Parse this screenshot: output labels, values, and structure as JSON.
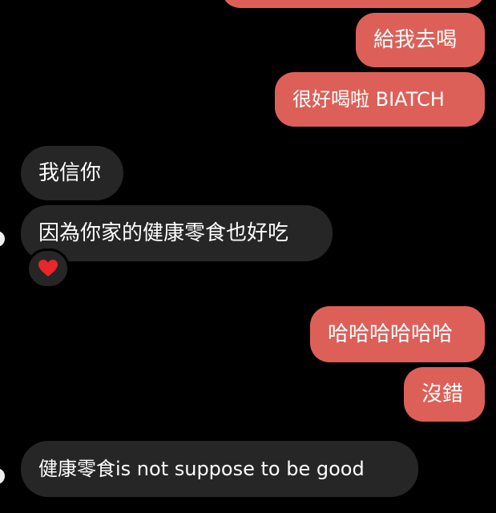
{
  "messages": {
    "outgoing": [
      {
        "text": "給我去喝"
      },
      {
        "text": "很好喝啦 BIATCH"
      },
      {
        "text": "哈哈哈哈哈哈"
      },
      {
        "text": "沒錯"
      }
    ],
    "incoming": [
      {
        "text": "我信你"
      },
      {
        "text": "因為你家的健康零食也好吃"
      },
      {
        "text": "健康零食is not suppose to be good"
      }
    ]
  },
  "reaction": {
    "icon": "heart-icon",
    "color": "#E8262B"
  },
  "colors": {
    "background": "#000000",
    "outgoing_bubble": "#DD6058",
    "incoming_bubble": "#262626",
    "text": "#FFFFFF"
  }
}
